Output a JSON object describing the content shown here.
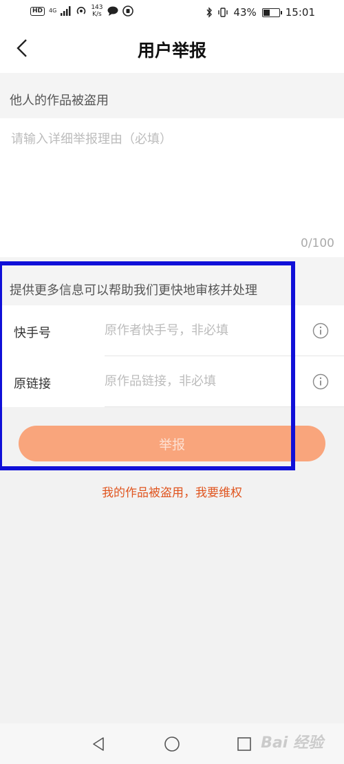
{
  "status_bar": {
    "hd": "HD",
    "network": "4G",
    "speed_value": "143",
    "speed_unit": "K/s",
    "battery": "43%",
    "time": "15:01"
  },
  "header": {
    "title": "用户举报"
  },
  "report_type": "他人的作品被盗用",
  "reason": {
    "placeholder": "请输入详细举报理由（必填）",
    "value": "",
    "counter": "0/100"
  },
  "more_info": {
    "title": "提供更多信息可以帮助我们更快地审核并处理",
    "fields": [
      {
        "label": "快手号",
        "placeholder": "原作者快手号，非必填"
      },
      {
        "label": "原链接",
        "placeholder": "原作品链接，非必填"
      }
    ]
  },
  "submit_label": "举报",
  "link_text": "我的作品被盗用，我要维权",
  "watermark": "Bai 经验",
  "colors": {
    "accent": "#f9a57c",
    "link": "#e0551f",
    "highlight": "#1010d8"
  },
  "battery_level": 0.43
}
